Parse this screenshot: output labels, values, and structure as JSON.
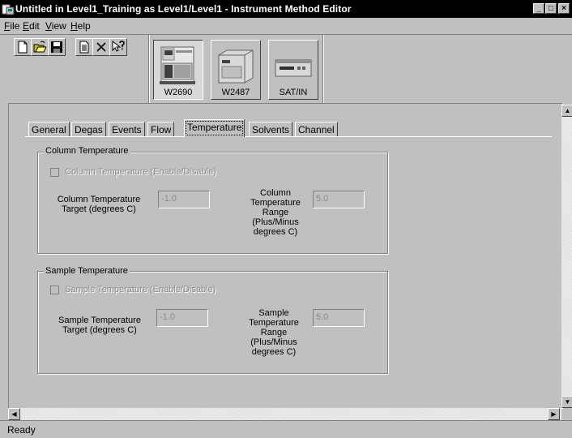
{
  "window": {
    "title": "Untitled in Level1_Training as Level1/Level1 - Instrument Method Editor",
    "min_glyph": "_",
    "max_glyph": "□",
    "close_glyph": "×"
  },
  "menu": {
    "file": "ile",
    "file_key": "F",
    "edit": "dit",
    "edit_key": "E",
    "view": "iew",
    "view_key": "V",
    "help": "elp",
    "help_key": "H"
  },
  "toolbar": {
    "icons": [
      "new-icon",
      "open-icon",
      "save-icon",
      "properties-icon",
      "delete-icon",
      "context-help-icon"
    ]
  },
  "instruments": [
    {
      "label": "W2690",
      "selected": true
    },
    {
      "label": "W2487",
      "selected": false
    },
    {
      "label": "SAT/IN",
      "selected": false
    }
  ],
  "tabs": [
    "General",
    "Degas",
    "Events",
    "Flow",
    "Temperature",
    "Solvents",
    "Channel"
  ],
  "active_tab": "Temperature",
  "column_group": {
    "title": "Column Temperature",
    "enable_label": "Column Temperature (Enable/Disable)",
    "enable_checked": false,
    "target_label_1": "Column Temperature",
    "target_label_2": "Target (degrees C)",
    "target_value": "-1.0",
    "range_label_1": "Column",
    "range_label_2": "Temperature",
    "range_label_3": "Range",
    "range_label_4": "(Plus/Minus",
    "range_label_5": "degrees C)",
    "range_value": "5.0"
  },
  "sample_group": {
    "title": "Sample Temperature",
    "enable_label": "Sample Temperature (Enable/Disable)",
    "enable_checked": false,
    "target_label_1": "Sample Temperature",
    "target_label_2": "Target (degrees C)",
    "target_value": "-1.0",
    "range_label_1": "Sample",
    "range_label_2": "Temperature",
    "range_label_3": "Range",
    "range_label_4": "(Plus/Minus",
    "range_label_5": "degrees C)",
    "range_value": "5.0"
  },
  "status": {
    "text": "Ready"
  },
  "colors": {
    "face": "#c0c0c0",
    "titlebar": "#000000",
    "disabled_text": "#8a8a8a"
  }
}
